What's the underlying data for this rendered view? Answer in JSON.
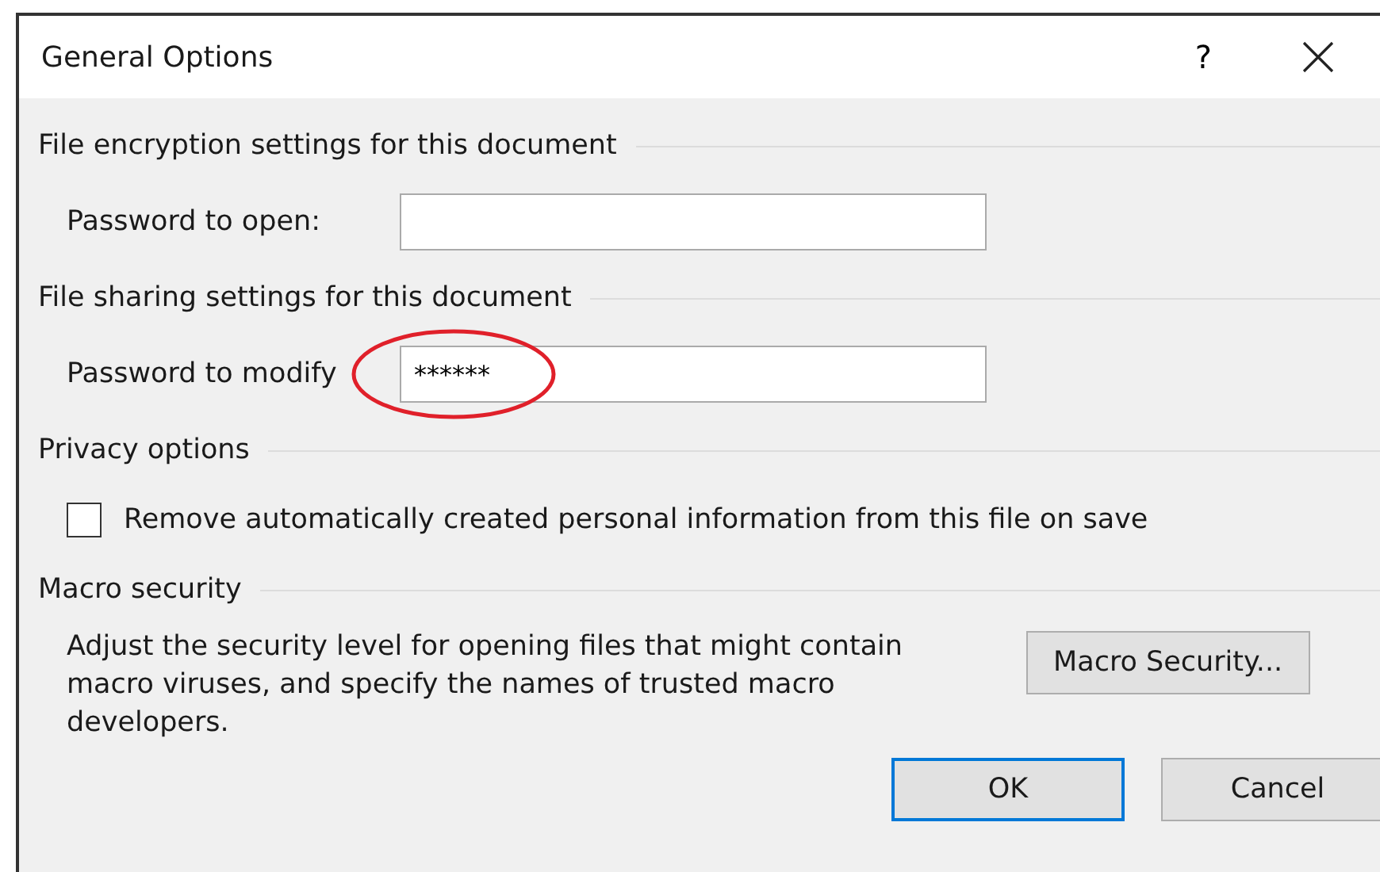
{
  "window": {
    "title": "General Options",
    "help": "?"
  },
  "sections": [
    {
      "kind": "password",
      "heading": "File encryption settings for this document",
      "label": "Password to open:",
      "circled": false
    },
    {
      "kind": "password",
      "heading": "File sharing settings for this document",
      "label": "Password to modify",
      "value": "******",
      "circled": true
    },
    {
      "kind": "checkbox",
      "heading": "Privacy options",
      "label": "Remove automatically created personal information from this file on save",
      "checked": false
    },
    {
      "kind": "macro",
      "heading": "Macro security",
      "text": "Adjust the security level for opening files that might contain macro viruses, and specify the names of trusted macro developers.",
      "button": "Macro Security..."
    }
  ],
  "buttons": [
    {
      "label": "OK",
      "default": true
    },
    {
      "label": "Cancel",
      "default": false
    }
  ]
}
